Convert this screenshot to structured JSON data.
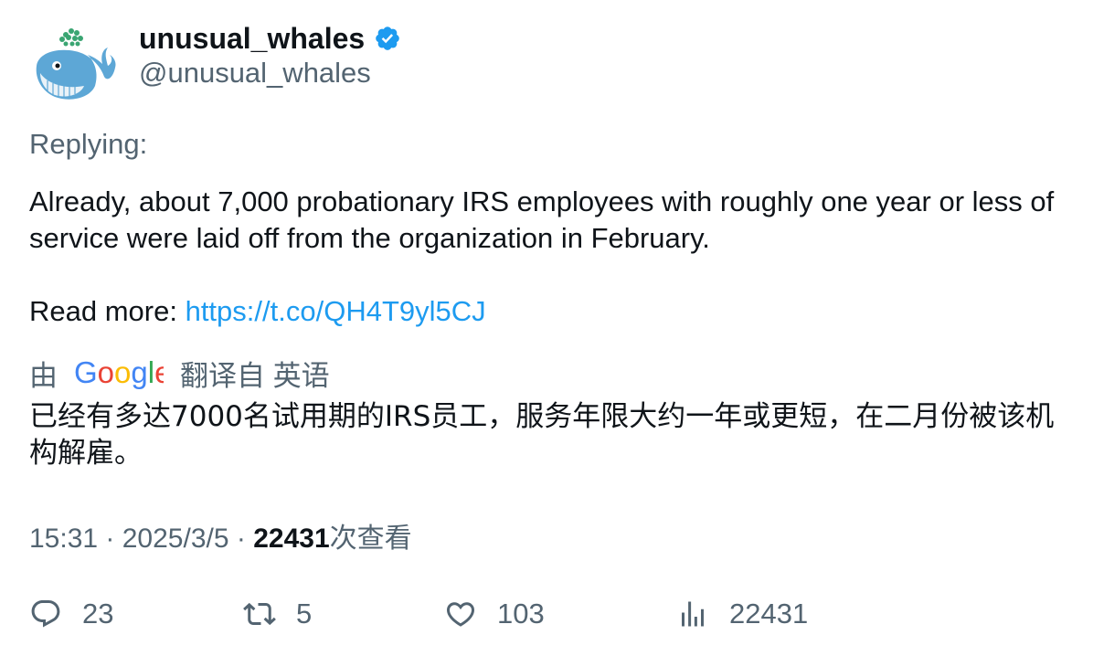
{
  "author": {
    "display_name": "unusual_whales",
    "handle": "@unusual_whales",
    "verified": true
  },
  "replying_label": "Replying:",
  "tweet": {
    "text": "Already, about 7,000 probationary IRS employees with roughly one year or less of service were laid off from the organization in February.",
    "read_more_label": "Read more: ",
    "link": "https://t.co/QH4T9yl5CJ"
  },
  "translation": {
    "prefix": "由",
    "provider": "Google",
    "suffix": "翻译自 英语",
    "text": "已经有多达7000名试用期的IRS员工，服务年限大约一年或更短，在二月份被该机构解雇。"
  },
  "meta": {
    "time": "15:31",
    "separator": " · ",
    "date": "2025/3/5",
    "views": "22431",
    "views_label": "次查看"
  },
  "actions": {
    "replies": "23",
    "retweets": "5",
    "likes": "103",
    "views": "22431"
  },
  "colors": {
    "text": "#0f1419",
    "secondary": "#536471",
    "link": "#1d9bf0",
    "verified": "#1d9bf0"
  },
  "icons": [
    "whale-avatar",
    "verified-badge-icon",
    "google-logo",
    "reply-icon",
    "retweet-icon",
    "like-icon",
    "views-icon"
  ]
}
